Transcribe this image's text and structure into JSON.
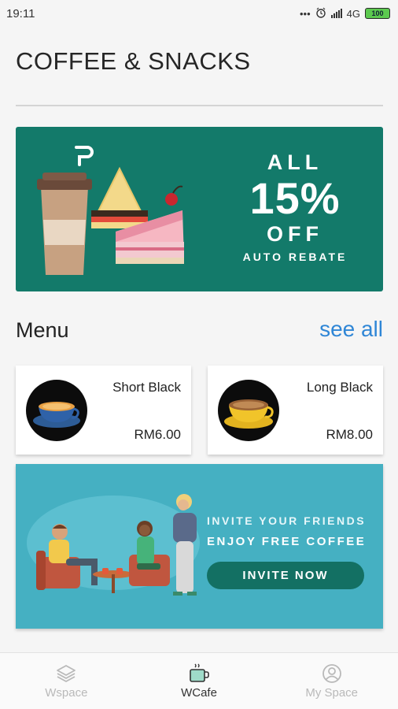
{
  "status_bar": {
    "time": "19:11",
    "dots": "•••",
    "network": "4G",
    "battery": "100"
  },
  "page": {
    "title": "COFFEE & SNACKS"
  },
  "promo": {
    "line1": "ALL",
    "percent": "15%",
    "line3": "OFF",
    "line4": "AUTO REBATE",
    "background_color": "#137a6a"
  },
  "menu": {
    "heading": "Menu",
    "see_all": "see all",
    "items": [
      {
        "name": "Short Black",
        "price": "RM6.00",
        "icon": "blue-espresso-cup"
      },
      {
        "name": "Long Black",
        "price": "RM8.00",
        "icon": "yellow-coffee-cup"
      }
    ]
  },
  "invite": {
    "line1": "INVITE YOUR FRIENDS",
    "line2": "ENJOY FREE COFFEE",
    "button": "INVITE NOW",
    "background_color": "#45b0c2"
  },
  "bottom_nav": {
    "items": [
      {
        "label": "Wspace",
        "icon": "layers-icon",
        "active": false
      },
      {
        "label": "WCafe",
        "icon": "coffee-cup-icon",
        "active": true
      },
      {
        "label": "My Space",
        "icon": "user-icon",
        "active": false
      }
    ]
  },
  "colors": {
    "accent_link": "#2f86d6",
    "button_green": "#137063"
  }
}
